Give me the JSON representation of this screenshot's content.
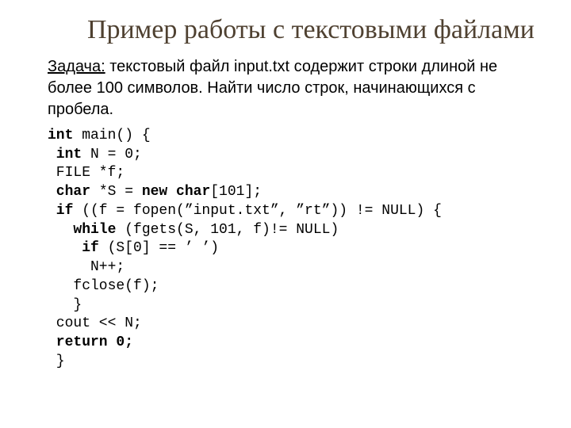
{
  "title": "Пример работы с текстовыми файлами",
  "task": {
    "label": "Задача:",
    "text": " текстовый файл input.txt содержит строки длиной не более 100 символов. Найти число строк, начинающихся с пробела."
  },
  "code": {
    "l1_kw": "int",
    "l1_rest": " main() {",
    "l2_kw": " int",
    "l2_rest": " N = 0;",
    "l3": " FILE *f;",
    "l4_kw": " char",
    "l4_mid": " *S = ",
    "l4_kw2": "new char",
    "l4_rest": "[101];",
    "l5_kw": " if",
    "l5_rest": " ((f = fopen(”input.txt”, ”rt”)) != NULL) {",
    "l6_kw": "   while",
    "l6_rest": " (fgets(S, 101, f)!= NULL)",
    "l7_kw": "    if",
    "l7_rest": " (S[0] == ’ ’)",
    "l8": "     N++;",
    "l9": "   fclose(f);",
    "l10": "   }",
    "l11": " cout << N;",
    "l12_kw": " return 0;",
    "l13": " }"
  }
}
